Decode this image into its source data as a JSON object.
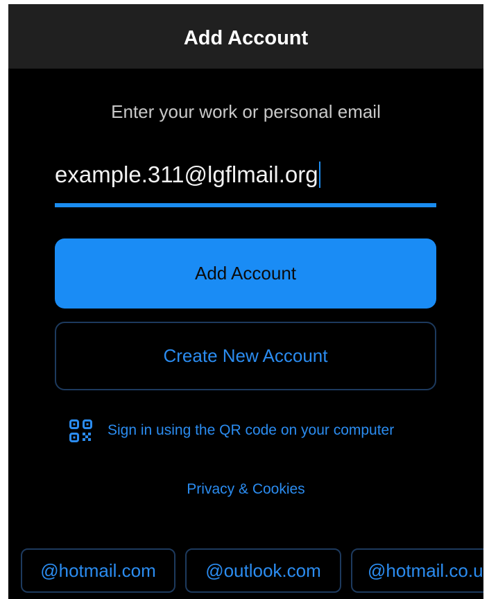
{
  "header": {
    "title": "Add Account"
  },
  "form": {
    "prompt": "Enter your work or personal email",
    "email_value": "example.311@lgflmail.org"
  },
  "buttons": {
    "add_account": "Add Account",
    "create_new_account": "Create New Account"
  },
  "qr": {
    "icon": "qr-code-icon",
    "label": "Sign in using the QR code on your computer"
  },
  "links": {
    "privacy": "Privacy & Cookies"
  },
  "domain_suggestions": [
    "@hotmail.com",
    "@outlook.com",
    "@hotmail.co.u"
  ],
  "colors": {
    "accent": "#1a8cf5",
    "link": "#2b8cf0",
    "background": "#000000",
    "header_background": "#202020"
  }
}
